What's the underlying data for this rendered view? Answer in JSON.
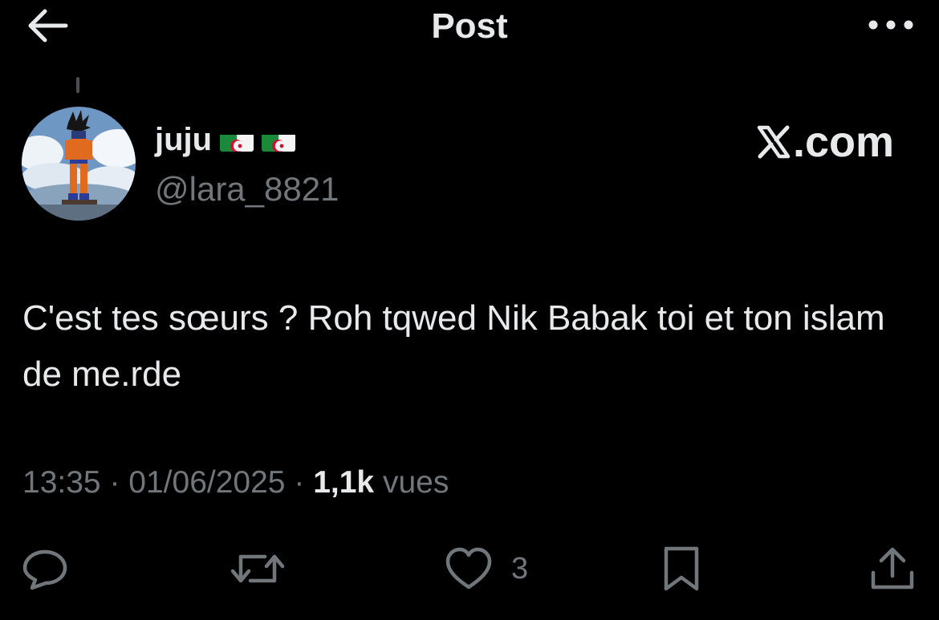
{
  "header": {
    "title": "Post"
  },
  "author": {
    "display_name": "juju",
    "handle": "@lara_8821",
    "flags": [
      "algeria-flag",
      "algeria-flag"
    ]
  },
  "watermark": {
    "logo": "x-logo",
    "text": ".com"
  },
  "post": {
    "text": "C'est tes sœurs ? Roh tqwed Nik Babak toi et ton islam de me.rde",
    "time": "13:35",
    "separator": "·",
    "date": "01/06/2025",
    "views_count": "1,1k",
    "views_label": "vues"
  },
  "actions": {
    "like_count": "3"
  },
  "colors": {
    "background": "#000000",
    "text": "#e7e9ea",
    "muted": "#71767b"
  }
}
